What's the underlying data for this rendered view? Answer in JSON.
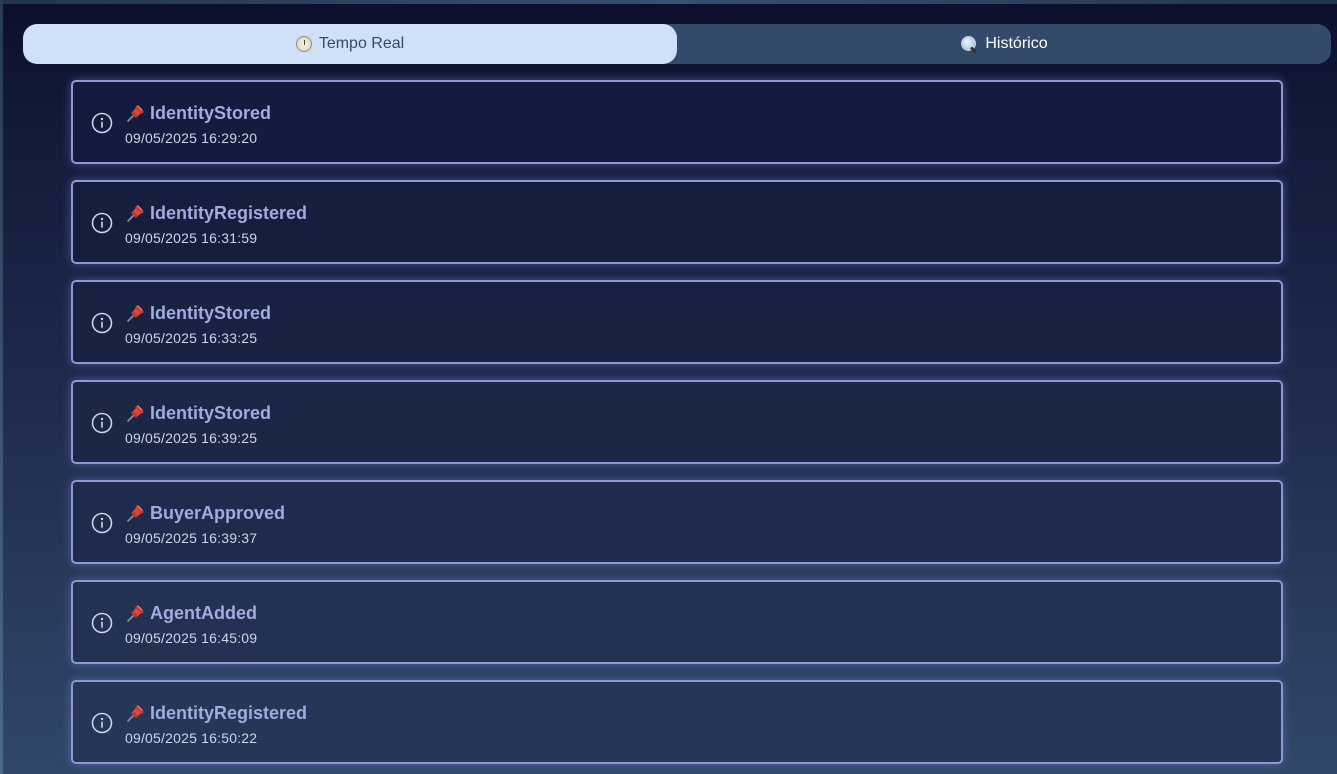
{
  "tabs": [
    {
      "label": "Tempo Real",
      "icon": "clock-icon",
      "active": true
    },
    {
      "label": "Histórico",
      "icon": "search-icon",
      "active": false
    }
  ],
  "events": [
    {
      "name": "IdentityStored",
      "time": "09/05/2025 16:29:20"
    },
    {
      "name": "IdentityRegistered",
      "time": "09/05/2025 16:31:59"
    },
    {
      "name": "IdentityStored",
      "time": "09/05/2025 16:33:25"
    },
    {
      "name": "IdentityStored",
      "time": "09/05/2025 16:39:25"
    },
    {
      "name": "BuyerApproved",
      "time": "09/05/2025 16:39:37"
    },
    {
      "name": "AgentAdded",
      "time": "09/05/2025 16:45:09"
    },
    {
      "name": "IdentityRegistered",
      "time": "09/05/2025 16:50:22"
    }
  ],
  "colors": {
    "active_tab_bg": "#cfe0f7",
    "inactive_tab_bg": "#334a6a",
    "card_border": "#8e96d6",
    "event_name": "#a2abe0",
    "pin": "#c0392b"
  }
}
